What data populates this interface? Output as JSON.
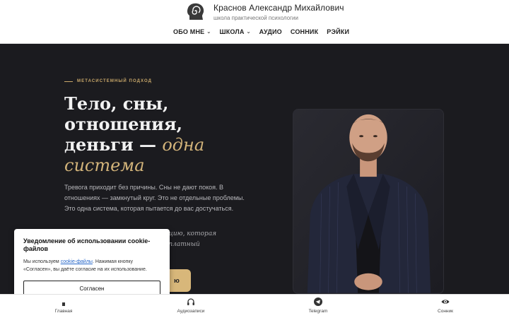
{
  "brand": {
    "name": "Краснов Александр Михайлович",
    "subtitle": "школа практической психологии"
  },
  "nav": {
    "items": [
      {
        "label": "ОБО МНЕ",
        "dropdown": true
      },
      {
        "label": "ШКОЛА",
        "dropdown": true
      },
      {
        "label": "АУДИО",
        "dropdown": false
      },
      {
        "label": "СОННИК",
        "dropdown": false
      },
      {
        "label": "РЭЙКИ",
        "dropdown": false
      }
    ]
  },
  "hero": {
    "kicker": "МЕТАСИСТЕМНЫЙ ПОДХОД",
    "title_line1": "Тело, сны,",
    "title_line2": "отношения,",
    "title_line3_plain": "деньги — ",
    "title_line3_accent": "одна",
    "title_line4_accent": "система",
    "lead": "Тревога приходит без причины. Сны не дают покоя. В отношениях — замкнутый круг. Это не отдельные проблемы. Это одна система, которая пытается до вас достучаться.",
    "lead2_line1": "уацию, которая",
    "lead2_line2": "есплатный",
    "cta_label": "ю"
  },
  "cookie": {
    "title": "Уведомление об использовании cookie-файлов",
    "text_before": "Мы используем ",
    "link": "cookie-файлы",
    "text_after": ". Нажимая кнопку «Согласен», вы даёте согласие на их использование.",
    "button": "Согласен"
  },
  "bottom_nav": {
    "items": [
      {
        "label": "Главная",
        "icon": "home-icon"
      },
      {
        "label": "Аудиозаписи",
        "icon": "headphones-icon"
      },
      {
        "label": "Telegram",
        "icon": "telegram-icon"
      },
      {
        "label": "Сонник",
        "icon": "eye-icon"
      }
    ]
  },
  "colors": {
    "accent": "#d3b47a",
    "hero_bg": "#1b1b1f",
    "link": "#2767c9"
  }
}
